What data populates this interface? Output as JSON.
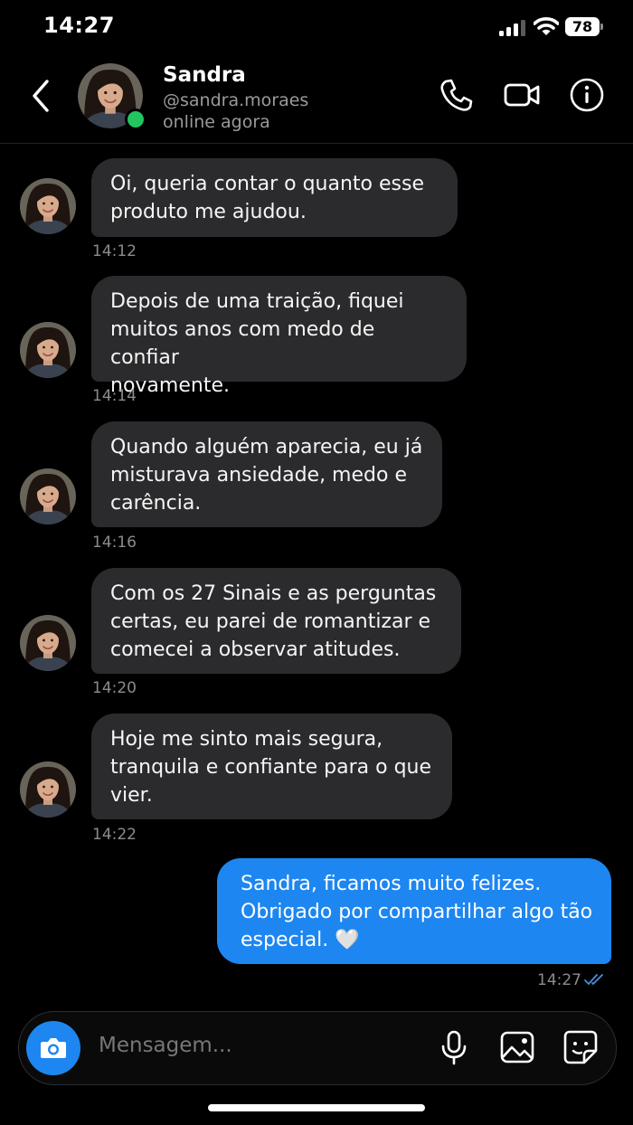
{
  "status_bar": {
    "time": "14:27",
    "battery": "78"
  },
  "header": {
    "name": "Sandra",
    "handle": "@sandra.moraes",
    "presence": "online agora",
    "icons": [
      "back-chevron-icon",
      "phone-icon",
      "video-camera-icon",
      "info-icon"
    ]
  },
  "messages": [
    {
      "direction": "in",
      "text": "Oi, queria contar o quanto esse\nproduto me ajudou.",
      "time": "14:12"
    },
    {
      "direction": "in",
      "text": "Depois de uma traição, fiquei\nmuitos anos com medo de confiar\nnovamente.",
      "time": "14:14"
    },
    {
      "direction": "in",
      "text": "Quando alguém aparecia, eu já\nmisturava ansiedade, medo e\ncarência.",
      "time": "14:16"
    },
    {
      "direction": "in",
      "text": "Com os 27 Sinais e as perguntas\ncertas, eu parei de romantizar e\ncomecei a observar atitudes.",
      "time": "14:20"
    },
    {
      "direction": "in",
      "text": "Hoje me sinto mais segura,\ntranquila e confiante para o que\nvier.",
      "time": "14:22"
    },
    {
      "direction": "out",
      "text": "Sandra, ficamos muito felizes.\nObrigado por compartilhar algo tão\nespecial. 🤍",
      "time": "14:27",
      "read": true
    }
  ],
  "composer": {
    "placeholder": "Mensagem...",
    "icons": [
      "camera-icon",
      "microphone-icon",
      "gallery-icon",
      "sticker-icon"
    ]
  },
  "colors": {
    "outgoing_bubble": "#1d86f0",
    "incoming_bubble": "#2b2b2d",
    "online": "#22c55e"
  }
}
